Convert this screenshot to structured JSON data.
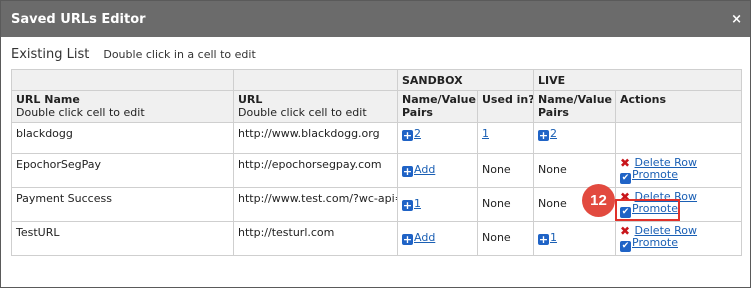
{
  "dialog": {
    "title": "Saved URLs Editor",
    "close_label": "×"
  },
  "section": {
    "title": "Existing List",
    "hint": "Double click in a cell to edit"
  },
  "groups": {
    "sandbox": "SANDBOX",
    "live": "LIVE"
  },
  "columns": {
    "url_name": "URL Name",
    "url_name_sub": "Double click cell to edit",
    "url": "URL",
    "url_sub": "Double click cell to edit",
    "name_value_pairs_line1": "Name/Value",
    "name_value_pairs_line2": "Pairs",
    "used_in": "Used in?",
    "actions": "Actions"
  },
  "rows": [
    {
      "name": "blackdogg",
      "url": "http://www.blackdogg.org",
      "sandbox_pairs": "2",
      "sandbox_used": "1",
      "live_pairs": "2",
      "live_used": "",
      "delete": "",
      "promote": ""
    },
    {
      "name": "EpochorSegPay",
      "url": "http://epochorsegpay.com",
      "sandbox_pairs": "Add",
      "sandbox_used": "None",
      "live_pairs": "None",
      "live_used": "",
      "delete": "Delete Row",
      "promote": "Promote"
    },
    {
      "name": "Payment Success",
      "url": "http://www.test.com/?wc-api=WC",
      "sandbox_pairs": "1",
      "sandbox_used": "None",
      "live_pairs": "None",
      "live_used": "",
      "delete": "Delete Row",
      "promote": "Promote"
    },
    {
      "name": "TestURL",
      "url": "http://testurl.com",
      "sandbox_pairs": "Add",
      "sandbox_used": "None",
      "live_pairs": "1",
      "live_used": "",
      "delete": "Delete Row",
      "promote": "Promote"
    }
  ],
  "annotation": {
    "step": "12"
  },
  "colors": {
    "title_bar": "#6b6b6b",
    "link": "#1a5fb4",
    "delete_icon": "#c8161b",
    "annotation": "#e24a3f"
  }
}
